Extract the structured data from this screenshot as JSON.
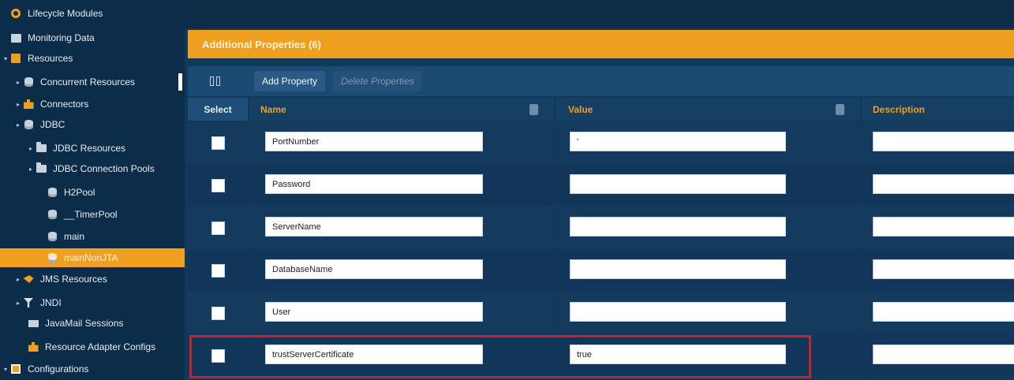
{
  "sidebar": {
    "items": [
      {
        "label": "Lifecycle Modules",
        "icon": "gear-icon",
        "arrow": ""
      },
      {
        "label": "Monitoring Data",
        "icon": "monitor-icon",
        "arrow": ""
      },
      {
        "label": "Resources",
        "icon": "resources-icon",
        "arrow": "▾"
      },
      {
        "label": "Concurrent Resources",
        "icon": "database-icon",
        "arrow": "▸"
      },
      {
        "label": "Connectors",
        "icon": "connector-icon",
        "arrow": "▸"
      },
      {
        "label": "JDBC",
        "icon": "database-icon",
        "arrow": "▸"
      },
      {
        "label": "JDBC Resources",
        "icon": "folder-icon",
        "arrow": "▸"
      },
      {
        "label": "JDBC Connection Pools",
        "icon": "folder-icon",
        "arrow": "▸"
      },
      {
        "label": "H2Pool",
        "icon": "database-icon",
        "arrow": ""
      },
      {
        "label": "__TimerPool",
        "icon": "database-icon",
        "arrow": ""
      },
      {
        "label": "main",
        "icon": "database-icon",
        "arrow": ""
      },
      {
        "label": "mainNonJTA",
        "icon": "database-icon",
        "arrow": ""
      },
      {
        "label": "JMS Resources",
        "icon": "jms-icon",
        "arrow": "▸"
      },
      {
        "label": "JNDI",
        "icon": "filter-icon",
        "arrow": "▸"
      },
      {
        "label": "JavaMail Sessions",
        "icon": "mail-icon",
        "arrow": ""
      },
      {
        "label": "Resource Adapter Configs",
        "icon": "connector-icon",
        "arrow": ""
      },
      {
        "label": "Configurations",
        "icon": "configurations-icon",
        "arrow": "▾"
      }
    ]
  },
  "panel": {
    "title": "Additional Properties (6)"
  },
  "toolbar": {
    "add_label": "Add Property",
    "delete_label": "Delete Properties"
  },
  "table": {
    "headers": {
      "select": "Select",
      "name": "Name",
      "value": "Value",
      "description": "Description"
    },
    "rows": [
      {
        "name": "PortNumber",
        "value": "'",
        "description": ""
      },
      {
        "name": "Password",
        "value": "",
        "description": ""
      },
      {
        "name": "ServerName",
        "value": "",
        "description": ""
      },
      {
        "name": "DatabaseName",
        "value": "",
        "description": ""
      },
      {
        "name": "User",
        "value": "",
        "description": ""
      },
      {
        "name": "trustServerCertificate",
        "value": "true",
        "description": ""
      }
    ]
  },
  "colors": {
    "accent": "#f0a020",
    "sidebar_bg": "#0c2d4a",
    "panel_bg": "#12385a",
    "highlight": "#c9202c"
  }
}
